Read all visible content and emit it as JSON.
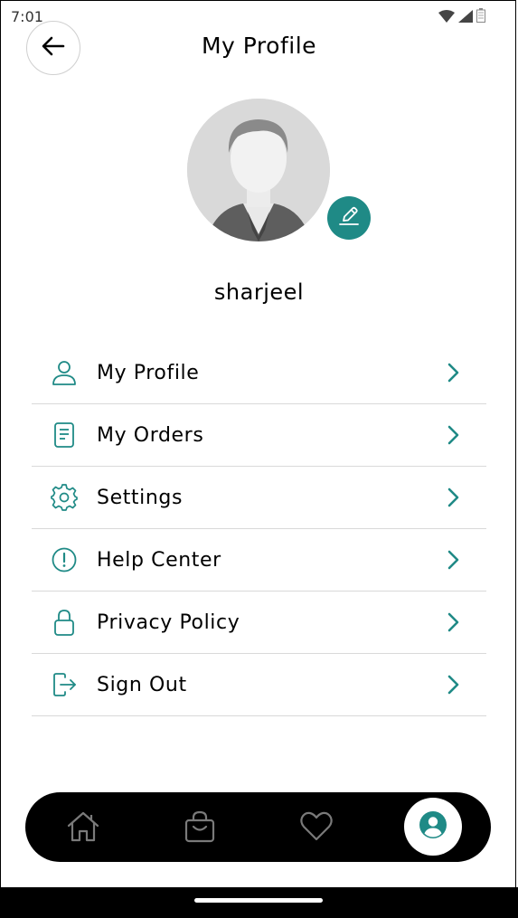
{
  "status_bar": {
    "time": "7:01",
    "icons": [
      "wifi-icon",
      "signal-icon",
      "battery-icon"
    ]
  },
  "header": {
    "title": "My Profile",
    "back_icon": "arrow-left-icon"
  },
  "profile": {
    "username": "sharjeel",
    "avatar": "default-user-avatar",
    "edit_icon": "pencil-icon"
  },
  "menu": {
    "items": [
      {
        "label": "My Profile",
        "icon": "user-icon"
      },
      {
        "label": "My Orders",
        "icon": "document-icon"
      },
      {
        "label": "Settings",
        "icon": "gear-icon"
      },
      {
        "label": "Help Center",
        "icon": "info-circle-icon"
      },
      {
        "label": "Privacy Policy",
        "icon": "lock-icon"
      },
      {
        "label": "Sign Out",
        "icon": "sign-out-icon"
      }
    ]
  },
  "bottom_nav": {
    "items": [
      "home-icon",
      "shopping-bag-icon",
      "heart-icon",
      "account-icon"
    ],
    "active": "account-icon"
  },
  "colors": {
    "accent": "#1f8a86",
    "text": "#000000",
    "divider": "#d9d9d9",
    "nav_background": "#000000"
  }
}
